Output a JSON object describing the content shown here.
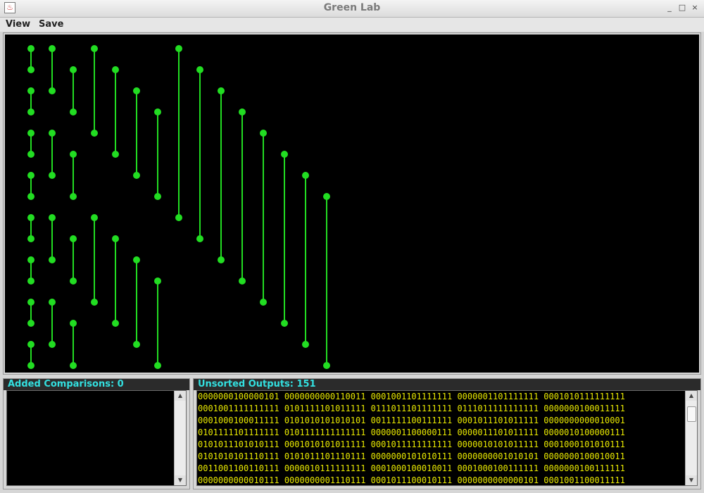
{
  "window": {
    "title": "Green Lab",
    "icon": "java-cup-icon",
    "controls": [
      "_",
      "□",
      "×"
    ]
  },
  "menu": {
    "items": [
      {
        "label": "View"
      },
      {
        "label": "Save"
      }
    ]
  },
  "network": {
    "wire_count": 16,
    "colors": {
      "background": "#000000",
      "wire_left": "#ff1a00",
      "wire_mid": "#ff7a00",
      "wire_right": "#ffcc00",
      "comparator": "#22dd22"
    },
    "comparators": [
      [
        [
          0,
          1
        ],
        [
          2,
          3
        ],
        [
          4,
          5
        ],
        [
          6,
          7
        ],
        [
          8,
          9
        ],
        [
          10,
          11
        ],
        [
          12,
          13
        ],
        [
          14,
          15
        ]
      ],
      [
        [
          0,
          2
        ],
        [
          4,
          6
        ],
        [
          8,
          10
        ],
        [
          12,
          14
        ]
      ],
      [
        [
          1,
          3
        ],
        [
          5,
          7
        ],
        [
          9,
          11
        ],
        [
          13,
          15
        ]
      ],
      [
        [
          0,
          4
        ],
        [
          8,
          12
        ]
      ],
      [
        [
          1,
          5
        ],
        [
          9,
          13
        ]
      ],
      [
        [
          2,
          6
        ],
        [
          10,
          14
        ]
      ],
      [
        [
          3,
          7
        ],
        [
          11,
          15
        ]
      ],
      [
        [
          0,
          8
        ]
      ],
      [
        [
          1,
          9
        ]
      ],
      [
        [
          2,
          10
        ]
      ],
      [
        [
          3,
          11
        ]
      ],
      [
        [
          4,
          12
        ]
      ],
      [
        [
          5,
          13
        ]
      ],
      [
        [
          6,
          14
        ]
      ],
      [
        [
          7,
          15
        ]
      ]
    ]
  },
  "added": {
    "label": "Added Comparisons: 0"
  },
  "outputs": {
    "label": "Unsorted Outputs: 151",
    "rows": [
      "0000000100000101 0000000000110011 0001001101111111 0000001101111111 0001010111111111",
      "0001001111111111 0101111101011111 0111011101111111 0111011111111111 0000000100011111",
      "0001000100011111 0101010101010101 0011111100111111 0001011101011111 0000000000010001",
      "0101111101111111 0101111111111111 0000001100000111 0000011101011111 0000010100000111",
      "0101011101010111 0001010101011111 0001011111111111 0000010101011111 0001000101010111",
      "0101010101110111 0101011101110111 0000000101010111 0000000001010101 0000000100010011",
      "0011001100110111 0000010111111111 0001000100010011 0001000100111111 0000000100111111",
      "0000000000010111 0000000001110111 0001011100010111 0000000000000101 0001001100011111"
    ]
  }
}
